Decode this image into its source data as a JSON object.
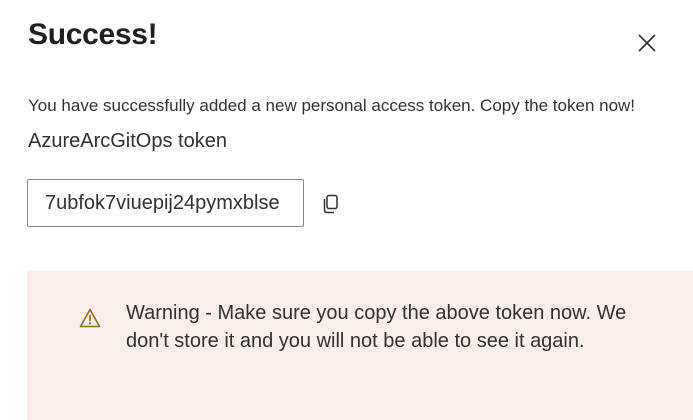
{
  "dialog": {
    "title": "Success!",
    "close_icon": "close-icon",
    "message": "You have successfully added a new personal access token. Copy the token now!",
    "token_name": "AzureArcGitOps token",
    "token_value": "7ubfok7viuepij24pymxblse",
    "copy_icon": "copy-icon",
    "warning": {
      "icon": "warning-triangle-icon",
      "text": "Warning - Make sure you copy the above token now. We don't store it and you will not be able to see it again."
    },
    "colors": {
      "warning_background": "#f9eeea",
      "warning_icon": "#8a6d1b",
      "input_border": "#8a8886"
    }
  }
}
